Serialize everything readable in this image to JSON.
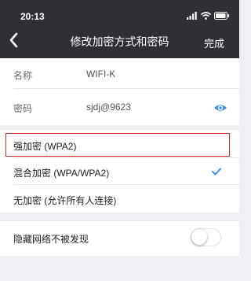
{
  "status_bar": {
    "time": "20:13",
    "icons": [
      "signal-icon",
      "wifi-icon",
      "battery-icon"
    ]
  },
  "navbar": {
    "back_icon": "chevron-left-icon",
    "title": "修改加密方式和密码",
    "done_label": "完成"
  },
  "network": {
    "name_label": "名称",
    "name_value": "WIFI-K",
    "password_label": "密码",
    "password_value": "sjdj@9623",
    "password_toggle_icon": "eye-icon"
  },
  "encryption": {
    "options": [
      {
        "label": "强加密 (WPA2)",
        "selected": false,
        "highlighted": true
      },
      {
        "label": "混合加密 (WPA/WPA2)",
        "selected": true
      },
      {
        "label": "无加密 (允许所有人连接)",
        "selected": false
      }
    ],
    "check_icon": "checkmark-icon"
  },
  "hidden_network": {
    "label": "隐藏网络不被发现",
    "enabled": false
  },
  "colors": {
    "header_bg": "#2e3036",
    "page_bg": "#efeff4",
    "accent": "#3a8ee6",
    "highlight_border": "#d22b2b"
  }
}
